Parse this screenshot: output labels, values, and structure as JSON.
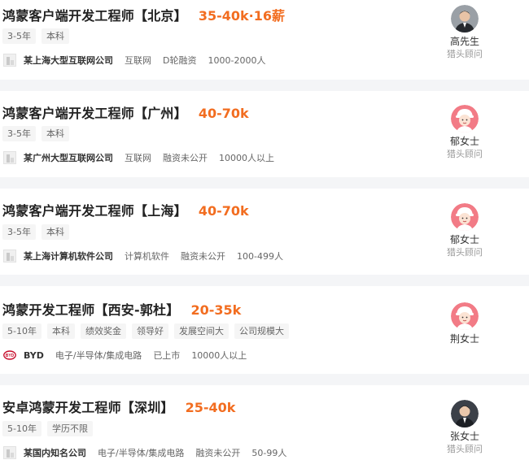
{
  "jobs": [
    {
      "title": "鸿蒙客户端开发工程师【北京】",
      "salary": "35-40k·16薪",
      "tags": [
        "3-5年",
        "本科"
      ],
      "company": {
        "name": "某上海大型互联网公司",
        "logo": "building-icon",
        "meta": [
          "互联网",
          "D轮融资",
          "1000-2000人"
        ]
      },
      "recruiter": {
        "name": "高先生",
        "role": "猎头顾问",
        "avatar": "man-suit-avatar"
      }
    },
    {
      "title": "鸿蒙客户端开发工程师【广州】",
      "salary": "40-70k",
      "tags": [
        "3-5年",
        "本科"
      ],
      "company": {
        "name": "某广州大型互联网公司",
        "logo": "building-icon",
        "meta": [
          "互联网",
          "融资未公开",
          "10000人以上"
        ]
      },
      "recruiter": {
        "name": "郁女士",
        "role": "猎头顾问",
        "avatar": "woman-cartoon-avatar"
      }
    },
    {
      "title": "鸿蒙客户端开发工程师【上海】",
      "salary": "40-70k",
      "tags": [
        "3-5年",
        "本科"
      ],
      "company": {
        "name": "某上海计算机软件公司",
        "logo": "building-icon",
        "meta": [
          "计算机软件",
          "融资未公开",
          "100-499人"
        ]
      },
      "recruiter": {
        "name": "郁女士",
        "role": "猎头顾问",
        "avatar": "woman-cartoon-avatar"
      }
    },
    {
      "title": "鸿蒙开发工程师【西安-郭杜】",
      "salary": "20-35k",
      "tags": [
        "5-10年",
        "本科",
        "绩效奖金",
        "领导好",
        "发展空间大",
        "公司规模大"
      ],
      "company": {
        "name": "BYD",
        "logo": "byd-logo-icon",
        "meta": [
          "电子/半导体/集成电路",
          "已上市",
          "10000人以上"
        ]
      },
      "recruiter": {
        "name": "荆女士",
        "role": "",
        "avatar": "woman-cartoon-avatar"
      }
    },
    {
      "title": "安卓鸿蒙开发工程师【深圳】",
      "salary": "25-40k",
      "tags": [
        "5-10年",
        "学历不限"
      ],
      "company": {
        "name": "某国内知名公司",
        "logo": "building-icon",
        "meta": [
          "电子/半导体/集成电路",
          "融资未公开",
          "50-99人"
        ]
      },
      "recruiter": {
        "name": "张女士",
        "role": "猎头顾问",
        "avatar": "man-suit-avatar"
      }
    }
  ],
  "colors": {
    "salary": "#f26d20",
    "background": "#f4f5f7",
    "card": "#ffffff",
    "byd_red": "#c8102e"
  }
}
